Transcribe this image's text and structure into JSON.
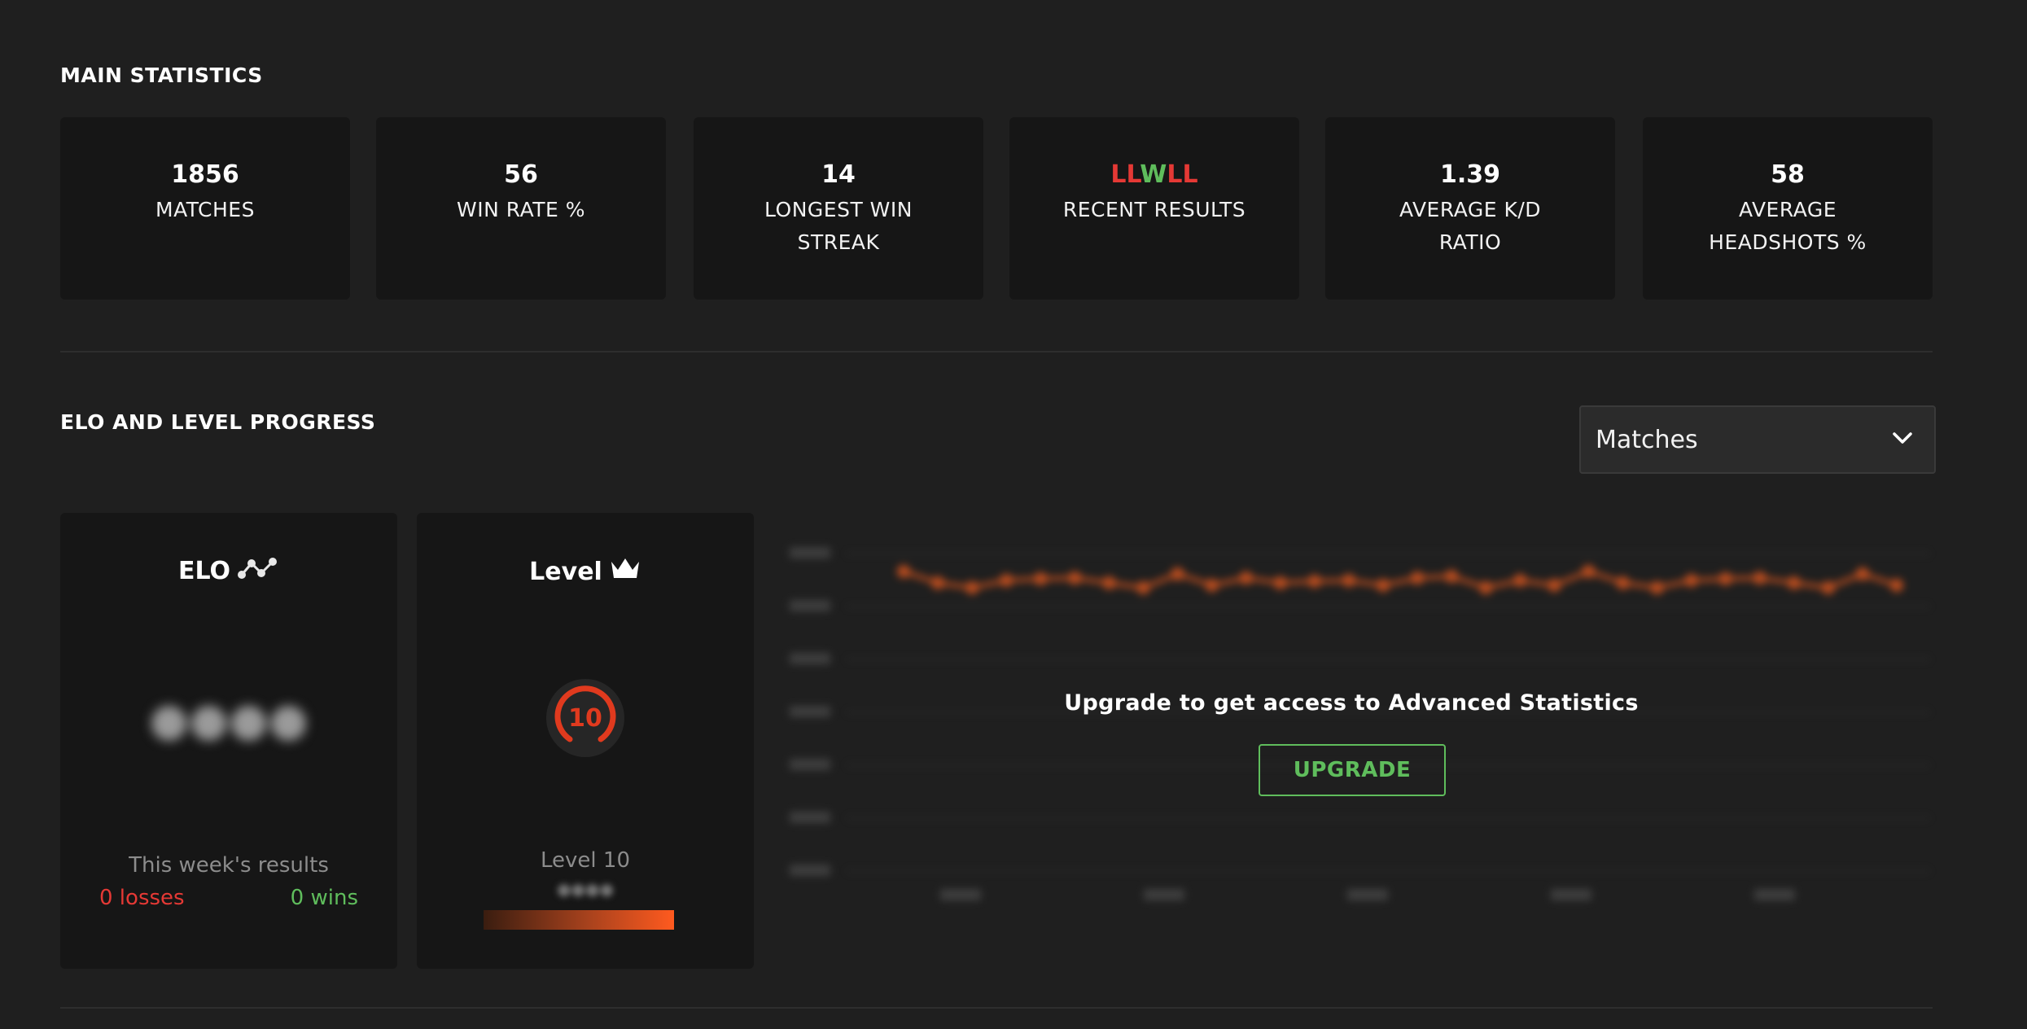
{
  "main_stats": {
    "title": "MAIN STATISTICS",
    "cards": [
      {
        "value": "1856",
        "label": "MATCHES"
      },
      {
        "value": "56",
        "label": "WIN RATE %"
      },
      {
        "value": "14",
        "label": "LONGEST WIN STREAK"
      },
      {
        "recent_results": [
          "L",
          "L",
          "W",
          "L",
          "L"
        ],
        "label": "RECENT RESULTS"
      },
      {
        "value": "1.39",
        "label": "AVERAGE K/D RATIO"
      },
      {
        "value": "58",
        "label": "AVERAGE HEADSHOTS %"
      }
    ]
  },
  "progress": {
    "title": "ELO AND LEVEL PROGRESS",
    "dropdown": {
      "value": "Matches"
    },
    "elo_panel": {
      "title": "ELO",
      "icon": "chart-line-icon",
      "week_label": "This week's results",
      "losses": "0 losses",
      "wins": "0 wins"
    },
    "level_panel": {
      "title": "Level",
      "icon": "crown-icon",
      "level_number": "10",
      "level_text": "Level 10"
    },
    "chart": {
      "upgrade_message": "Upgrade to get access to Advanced Statistics",
      "upgrade_button": "UPGRADE"
    }
  },
  "colors": {
    "background": "#1f1f1f",
    "card": "#161616",
    "loss": "#e53935",
    "win": "#5fbd5c",
    "accent_orange": "#ff5a1f"
  }
}
